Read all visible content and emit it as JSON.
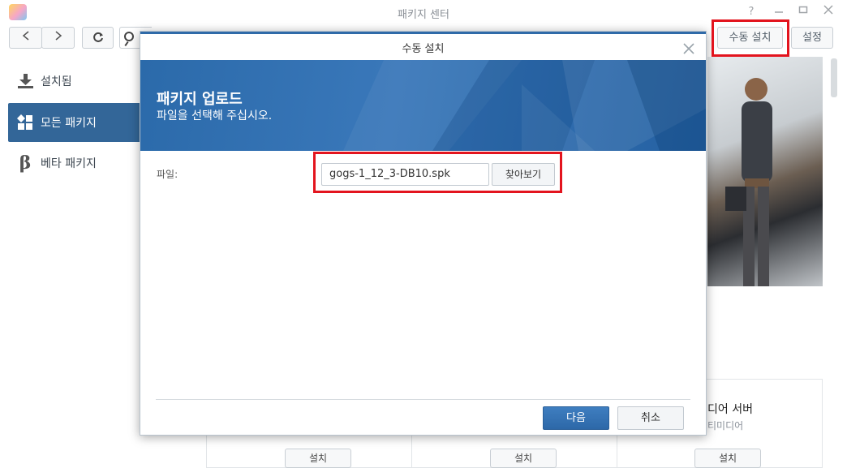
{
  "window": {
    "title": "패키지 센터"
  },
  "toolbar": {
    "manual_install_label": "수동 설치",
    "settings_label": "설정"
  },
  "sidebar": {
    "items": [
      {
        "label": "설치됨",
        "icon": "download-icon"
      },
      {
        "label": "모든 패키지",
        "icon": "grid-icon"
      },
      {
        "label": "베타 패키지",
        "icon": "beta-icon"
      }
    ]
  },
  "background": {
    "card_title": "디어 서버",
    "card_subtitle": "티미디어",
    "install_labels": [
      "설치",
      "설치",
      "설치"
    ]
  },
  "modal": {
    "title": "수동 설치",
    "banner_title": "패키지 업로드",
    "banner_subtitle": "파일을 선택해 주십시오.",
    "file_label": "파일:",
    "file_value": "gogs-1_12_3-DB10.spk",
    "browse_label": "찾아보기",
    "next_label": "다음",
    "cancel_label": "취소"
  },
  "colors": {
    "accent": "#336698",
    "highlight": "#e3141e"
  }
}
